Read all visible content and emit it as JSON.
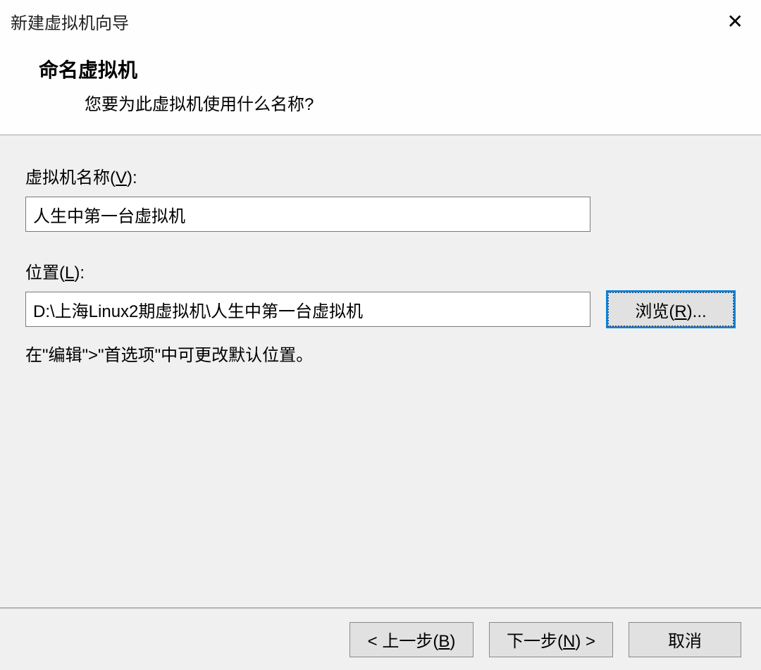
{
  "window": {
    "title": "新建虚拟机向导"
  },
  "header": {
    "heading": "命名虚拟机",
    "subtitle": "您要为此虚拟机使用什么名称?"
  },
  "form": {
    "name_label_pre": "虚拟机名称(",
    "name_label_key": "V",
    "name_label_post": "):",
    "name_value": "人生中第一台虚拟机",
    "location_label_pre": "位置(",
    "location_label_key": "L",
    "location_label_post": "):",
    "location_value": "D:\\上海Linux2期虚拟机\\人生中第一台虚拟机",
    "browse_pre": "浏览(",
    "browse_key": "R",
    "browse_post": ")...",
    "hint": "在\"编辑\">\"首选项\"中可更改默认位置。"
  },
  "footer": {
    "back_pre": "< 上一步(",
    "back_key": "B",
    "back_post": ")",
    "next_pre": "下一步(",
    "next_key": "N",
    "next_post": ") >",
    "cancel": "取消"
  }
}
